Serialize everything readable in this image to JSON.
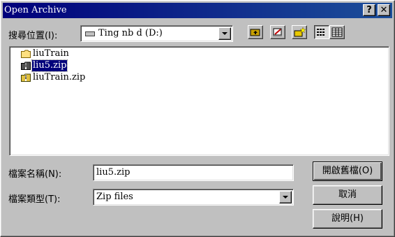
{
  "window": {
    "title": "Open Archive"
  },
  "title_buttons": {
    "help": "?",
    "close": "✕"
  },
  "look_in": {
    "label": "搜尋位置(I):",
    "value": "Ting nb d (D:)"
  },
  "toolbar": [
    "up-folder-icon",
    "desktop-icon",
    "new-folder-icon",
    "list-view-icon",
    "details-view-icon"
  ],
  "files": [
    {
      "name": "liuTrain",
      "icon": "folder-icon",
      "selected": false
    },
    {
      "name": "liu5.zip",
      "icon": "zip-file-icon",
      "selected": true
    },
    {
      "name": "liuTrain.zip",
      "icon": "zip-file-icon",
      "selected": false
    }
  ],
  "filename": {
    "label": "檔案名稱(N):",
    "value": "liu5.zip"
  },
  "filetype": {
    "label": "檔案類型(T):",
    "value": "Zip files"
  },
  "buttons": {
    "open": "開啟舊檔(O)",
    "cancel": "取消",
    "help": "說明(H)"
  }
}
